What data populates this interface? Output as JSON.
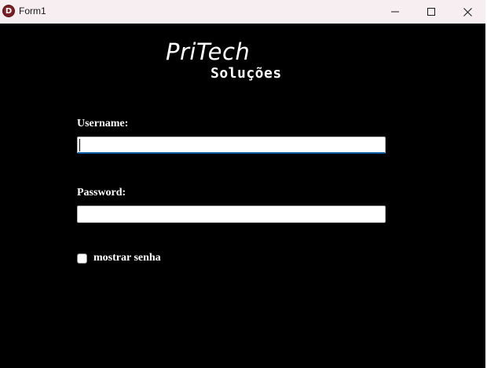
{
  "window": {
    "title": "Form1",
    "app_icon_letter": "D",
    "controls": {
      "minimize": "minimize-icon",
      "maximize": "maximize-icon",
      "close": "close-icon"
    }
  },
  "logo": {
    "main": "PriTech",
    "sub": "Soluções"
  },
  "form": {
    "username_label": "Username:",
    "username_value": "",
    "password_label": "Password:",
    "password_value": "",
    "show_password_label": "mostrar senha",
    "show_password_checked": false
  },
  "colors": {
    "background": "#000000",
    "titlebar": "#f6eef1",
    "focus_accent": "#005a9e",
    "text": "#ffffff"
  }
}
